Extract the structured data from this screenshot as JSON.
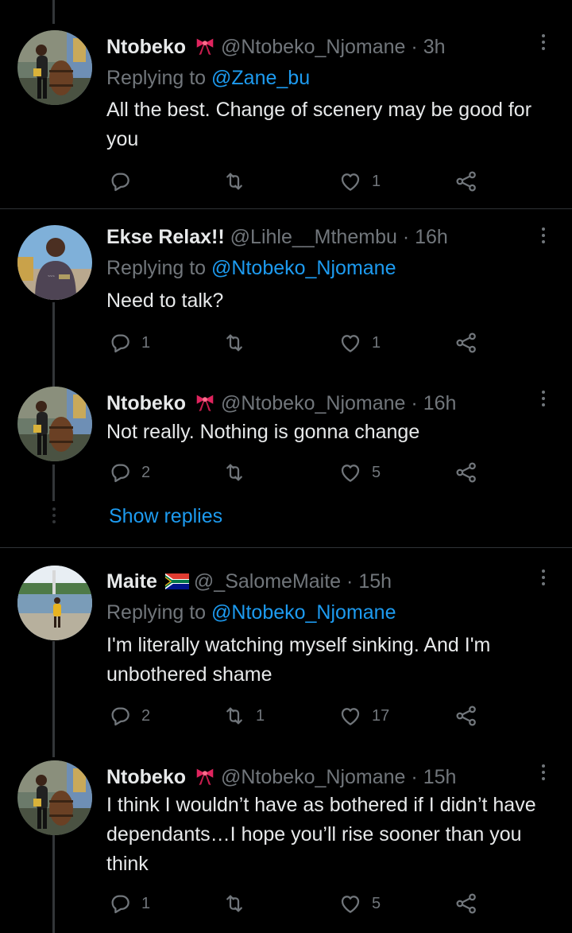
{
  "tweets": [
    {
      "name": "Ntobeko",
      "name_emoji": "ribbon-emoji",
      "handle": "@Ntobeko_Njomane",
      "dot": "·",
      "time": "3h",
      "replying_prefix": "Replying to",
      "replying_to": "@Zane_bu",
      "text": "All the best. Change of scenery may be good for you",
      "reply_count": "",
      "retweet_count": "",
      "like_count": "1"
    },
    {
      "name": "Ekse Relax!!",
      "handle": "@Lihle__Mthembu",
      "dot": "·",
      "time": "16h",
      "replying_prefix": "Replying to",
      "replying_to": "@Ntobeko_Njomane",
      "text": "Need to talk?",
      "reply_count": "1",
      "retweet_count": "",
      "like_count": "1"
    },
    {
      "name": "Ntobeko",
      "name_emoji": "ribbon-emoji",
      "handle": "@Ntobeko_Njomane",
      "dot": "·",
      "time": "16h",
      "text": "Not really. Nothing is gonna change",
      "reply_count": "2",
      "retweet_count": "",
      "like_count": "5"
    },
    {
      "name": "Maite",
      "name_emoji": "south-africa-flag-emoji",
      "handle": "@_SalomeMaite",
      "dot": "·",
      "time": "15h",
      "replying_prefix": "Replying to",
      "replying_to": "@Ntobeko_Njomane",
      "text": "I'm literally watching myself sinking. And I'm unbothered shame",
      "reply_count": "2",
      "retweet_count": "1",
      "like_count": "17"
    },
    {
      "name": "Ntobeko",
      "name_emoji": "ribbon-emoji",
      "handle": "@Ntobeko_Njomane",
      "dot": "·",
      "time": "15h",
      "text": "I think I wouldn’t have as bothered if I didn’t have dependants…I hope you’ll rise sooner than you think",
      "reply_count": "1",
      "retweet_count": "",
      "like_count": "5"
    }
  ],
  "show_replies_label": "Show replies",
  "colors": {
    "background": "#000000",
    "text": "#e7e9ea",
    "muted": "#71767b",
    "accent": "#1d9bf0",
    "divider": "#2f3336"
  }
}
